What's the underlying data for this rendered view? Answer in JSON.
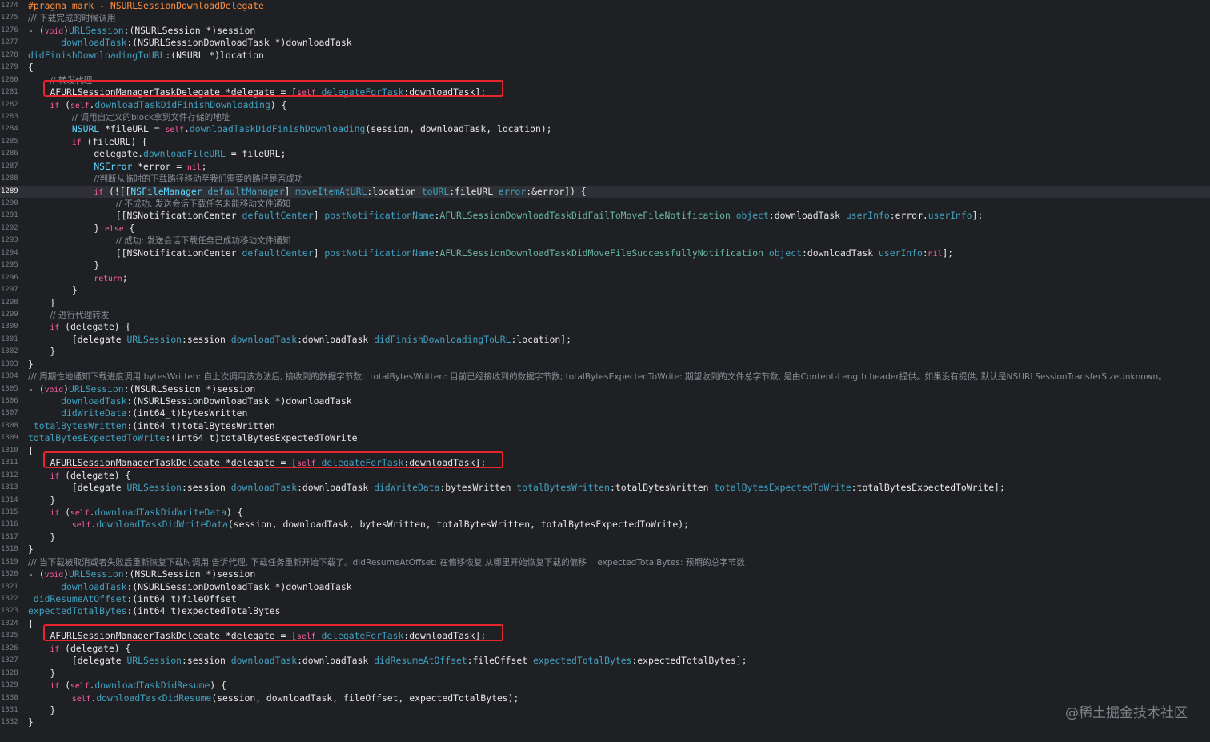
{
  "lines": [
    {
      "n": "1274",
      "indent": 0,
      "tokens": [
        {
          "t": "#pragma mark - NSURLSessionDownloadDelegate",
          "c": "pp"
        }
      ]
    },
    {
      "n": "1275",
      "indent": 0,
      "tokens": [
        {
          "t": "/// 下载完成的时候调用",
          "c": "cm"
        }
      ]
    },
    {
      "n": "1276",
      "indent": 0,
      "tokens": [
        {
          "t": "- (",
          "c": "pl"
        },
        {
          "t": "void",
          "c": "kw"
        },
        {
          "t": ")",
          "c": "pl"
        },
        {
          "t": "URLSession",
          "c": "mt"
        },
        {
          "t": ":(NSURLSession *)session",
          "c": "pl"
        }
      ]
    },
    {
      "n": "1277",
      "indent": 6,
      "tokens": [
        {
          "t": "downloadTask",
          "c": "mt"
        },
        {
          "t": ":(NSURLSessionDownloadTask *)downloadTask",
          "c": "pl"
        }
      ]
    },
    {
      "n": "1278",
      "indent": 0,
      "tokens": [
        {
          "t": "didFinishDownloadingToURL",
          "c": "mt"
        },
        {
          "t": ":(NSURL *)location",
          "c": "pl"
        }
      ]
    },
    {
      "n": "1279",
      "indent": 0,
      "tokens": [
        {
          "t": "{",
          "c": "pl"
        }
      ]
    },
    {
      "n": "1280",
      "indent": 4,
      "tokens": [
        {
          "t": "// 转发代理",
          "c": "cm"
        }
      ]
    },
    {
      "n": "1281",
      "indent": 4,
      "tokens": [
        {
          "t": "AFURLSessionManagerTaskDelegate *delegate = [",
          "c": "pl"
        },
        {
          "t": "self",
          "c": "kw"
        },
        {
          "t": " ",
          "c": "pl"
        },
        {
          "t": "delegateForTask",
          "c": "mt"
        },
        {
          "t": ":downloadTask];",
          "c": "pl"
        }
      ]
    },
    {
      "n": "1282",
      "indent": 4,
      "tokens": [
        {
          "t": "if",
          "c": "kw"
        },
        {
          "t": " (",
          "c": "pl"
        },
        {
          "t": "self",
          "c": "kw"
        },
        {
          "t": ".",
          "c": "pl"
        },
        {
          "t": "downloadTaskDidFinishDownloading",
          "c": "mt"
        },
        {
          "t": ") {",
          "c": "pl"
        }
      ]
    },
    {
      "n": "1283",
      "indent": 8,
      "tokens": [
        {
          "t": "// 调用自定义的block拿到文件存储的地址",
          "c": "cm"
        }
      ]
    },
    {
      "n": "1284",
      "indent": 8,
      "tokens": [
        {
          "t": "NSURL",
          "c": "ty"
        },
        {
          "t": " *fileURL = ",
          "c": "pl"
        },
        {
          "t": "self",
          "c": "kw"
        },
        {
          "t": ".",
          "c": "pl"
        },
        {
          "t": "downloadTaskDidFinishDownloading",
          "c": "mt"
        },
        {
          "t": "(session, downloadTask, location);",
          "c": "pl"
        }
      ]
    },
    {
      "n": "1285",
      "indent": 8,
      "tokens": [
        {
          "t": "if",
          "c": "kw"
        },
        {
          "t": " (fileURL) {",
          "c": "pl"
        }
      ]
    },
    {
      "n": "1286",
      "indent": 12,
      "tokens": [
        {
          "t": "delegate.",
          "c": "pl"
        },
        {
          "t": "downloadFileURL",
          "c": "mt"
        },
        {
          "t": " = fileURL;",
          "c": "pl"
        }
      ]
    },
    {
      "n": "1287",
      "indent": 12,
      "tokens": [
        {
          "t": "NSError",
          "c": "ty"
        },
        {
          "t": " *error = ",
          "c": "pl"
        },
        {
          "t": "nil",
          "c": "kw"
        },
        {
          "t": ";",
          "c": "pl"
        }
      ]
    },
    {
      "n": "1288",
      "indent": 12,
      "tokens": [
        {
          "t": "//判断从临时的下载路径移动至我们需要的路径是否成功",
          "c": "cm"
        }
      ]
    },
    {
      "n": "1289",
      "indent": 12,
      "current": true,
      "tokens": [
        {
          "t": "if",
          "c": "kw"
        },
        {
          "t": " (![[",
          "c": "pl"
        },
        {
          "t": "NSFileManager",
          "c": "ty"
        },
        {
          "t": " ",
          "c": "pl"
        },
        {
          "t": "defaultManager",
          "c": "mt"
        },
        {
          "t": "] ",
          "c": "pl"
        },
        {
          "t": "moveItemAtURL",
          "c": "mt"
        },
        {
          "t": ":location ",
          "c": "pl"
        },
        {
          "t": "toURL",
          "c": "mt"
        },
        {
          "t": ":fileURL ",
          "c": "pl"
        },
        {
          "t": "error",
          "c": "mt"
        },
        {
          "t": ":&error]) {",
          "c": "pl"
        }
      ]
    },
    {
      "n": "1290",
      "indent": 16,
      "tokens": [
        {
          "t": "// 不成功, 发送会话下载任务未能移动文件通知",
          "c": "cm"
        }
      ]
    },
    {
      "n": "1291",
      "indent": 16,
      "tokens": [
        {
          "t": "[[",
          "c": "pl"
        },
        {
          "t": "NSNotificationCenter",
          "c": "pl"
        },
        {
          "t": " ",
          "c": "pl"
        },
        {
          "t": "defaultCenter",
          "c": "mt"
        },
        {
          "t": "] ",
          "c": "pl"
        },
        {
          "t": "postNotificationName",
          "c": "mt"
        },
        {
          "t": ":",
          "c": "pl"
        },
        {
          "t": "AFURLSessionDownloadTaskDidFailToMoveFileNotification",
          "c": "fn"
        },
        {
          "t": " ",
          "c": "pl"
        },
        {
          "t": "object",
          "c": "mt"
        },
        {
          "t": ":downloadTask ",
          "c": "pl"
        },
        {
          "t": "userInfo",
          "c": "mt"
        },
        {
          "t": ":error.",
          "c": "pl"
        },
        {
          "t": "userInfo",
          "c": "mt"
        },
        {
          "t": "];",
          "c": "pl"
        }
      ]
    },
    {
      "n": "1292",
      "indent": 12,
      "tokens": [
        {
          "t": "} ",
          "c": "pl"
        },
        {
          "t": "else",
          "c": "kw"
        },
        {
          "t": " {",
          "c": "pl"
        }
      ]
    },
    {
      "n": "1293",
      "indent": 16,
      "tokens": [
        {
          "t": "// 成功: 发送会话下载任务已成功移动文件通知",
          "c": "cm"
        }
      ]
    },
    {
      "n": "1294",
      "indent": 16,
      "tokens": [
        {
          "t": "[[",
          "c": "pl"
        },
        {
          "t": "NSNotificationCenter",
          "c": "pl"
        },
        {
          "t": " ",
          "c": "pl"
        },
        {
          "t": "defaultCenter",
          "c": "mt"
        },
        {
          "t": "] ",
          "c": "pl"
        },
        {
          "t": "postNotificationName",
          "c": "mt"
        },
        {
          "t": ":",
          "c": "pl"
        },
        {
          "t": "AFURLSessionDownloadTaskDidMoveFileSuccessfullyNotification",
          "c": "fn"
        },
        {
          "t": " ",
          "c": "pl"
        },
        {
          "t": "object",
          "c": "mt"
        },
        {
          "t": ":downloadTask ",
          "c": "pl"
        },
        {
          "t": "userInfo",
          "c": "mt"
        },
        {
          "t": ":",
          "c": "pl"
        },
        {
          "t": "nil",
          "c": "kw"
        },
        {
          "t": "];",
          "c": "pl"
        }
      ]
    },
    {
      "n": "1295",
      "indent": 12,
      "tokens": [
        {
          "t": "}",
          "c": "pl"
        }
      ]
    },
    {
      "n": "1296",
      "indent": 12,
      "tokens": [
        {
          "t": "return",
          "c": "kw"
        },
        {
          "t": ";",
          "c": "pl"
        }
      ]
    },
    {
      "n": "1297",
      "indent": 8,
      "tokens": [
        {
          "t": "}",
          "c": "pl"
        }
      ]
    },
    {
      "n": "1298",
      "indent": 4,
      "tokens": [
        {
          "t": "}",
          "c": "pl"
        }
      ]
    },
    {
      "n": "1299",
      "indent": 4,
      "tokens": [
        {
          "t": "// 进行代理转发",
          "c": "cm"
        }
      ]
    },
    {
      "n": "1300",
      "indent": 4,
      "tokens": [
        {
          "t": "if",
          "c": "kw"
        },
        {
          "t": " (delegate) {",
          "c": "pl"
        }
      ]
    },
    {
      "n": "1301",
      "indent": 8,
      "tokens": [
        {
          "t": "[delegate ",
          "c": "pl"
        },
        {
          "t": "URLSession",
          "c": "mt"
        },
        {
          "t": ":session ",
          "c": "pl"
        },
        {
          "t": "downloadTask",
          "c": "mt"
        },
        {
          "t": ":downloadTask ",
          "c": "pl"
        },
        {
          "t": "didFinishDownloadingToURL",
          "c": "mt"
        },
        {
          "t": ":location];",
          "c": "pl"
        }
      ]
    },
    {
      "n": "1302",
      "indent": 4,
      "tokens": [
        {
          "t": "}",
          "c": "pl"
        }
      ]
    },
    {
      "n": "1303",
      "indent": 0,
      "tokens": [
        {
          "t": "}",
          "c": "pl"
        }
      ]
    },
    {
      "n": "1304",
      "indent": 0,
      "tokens": [
        {
          "t": "/// 周期性地通知下载进度调用 bytesWritten: 自上次调用该方法后, 接收到的数据字节数;  totalBytesWritten: 目前已经接收到的数据字节数; totalBytesExpectedToWrite: 期望收到的文件总字节数, 是由Content-Length header提供。如果没有提供, 默认是NSURLSessionTransferSizeUnknown。",
          "c": "cm"
        }
      ]
    },
    {
      "n": "1305",
      "indent": 0,
      "tokens": [
        {
          "t": "- (",
          "c": "pl"
        },
        {
          "t": "void",
          "c": "kw"
        },
        {
          "t": ")",
          "c": "pl"
        },
        {
          "t": "URLSession",
          "c": "mt"
        },
        {
          "t": ":(NSURLSession *)session",
          "c": "pl"
        }
      ]
    },
    {
      "n": "1306",
      "indent": 6,
      "tokens": [
        {
          "t": "downloadTask",
          "c": "mt"
        },
        {
          "t": ":(NSURLSessionDownloadTask *)downloadTask",
          "c": "pl"
        }
      ]
    },
    {
      "n": "1307",
      "indent": 6,
      "tokens": [
        {
          "t": "didWriteData",
          "c": "mt"
        },
        {
          "t": ":(int64_t)bytesWritten",
          "c": "pl"
        }
      ]
    },
    {
      "n": "1308",
      "indent": 1,
      "tokens": [
        {
          "t": "totalBytesWritten",
          "c": "mt"
        },
        {
          "t": ":(int64_t)totalBytesWritten",
          "c": "pl"
        }
      ]
    },
    {
      "n": "1309",
      "indent": 0,
      "tokens": [
        {
          "t": "totalBytesExpectedToWrite",
          "c": "mt"
        },
        {
          "t": ":(int64_t)totalBytesExpectedToWrite",
          "c": "pl"
        }
      ]
    },
    {
      "n": "1310",
      "indent": 0,
      "tokens": [
        {
          "t": "{",
          "c": "pl"
        }
      ]
    },
    {
      "n": "1311",
      "indent": 4,
      "tokens": [
        {
          "t": "AFURLSessionManagerTaskDelegate *delegate = [",
          "c": "pl"
        },
        {
          "t": "self",
          "c": "kw"
        },
        {
          "t": " ",
          "c": "pl"
        },
        {
          "t": "delegateForTask",
          "c": "mt"
        },
        {
          "t": ":downloadTask];",
          "c": "pl"
        }
      ]
    },
    {
      "n": "1312",
      "indent": 4,
      "tokens": [
        {
          "t": "if",
          "c": "kw"
        },
        {
          "t": " (delegate) {",
          "c": "pl"
        }
      ]
    },
    {
      "n": "1313",
      "indent": 8,
      "tokens": [
        {
          "t": "[delegate ",
          "c": "pl"
        },
        {
          "t": "URLSession",
          "c": "mt"
        },
        {
          "t": ":session ",
          "c": "pl"
        },
        {
          "t": "downloadTask",
          "c": "mt"
        },
        {
          "t": ":downloadTask ",
          "c": "pl"
        },
        {
          "t": "didWriteData",
          "c": "mt"
        },
        {
          "t": ":bytesWritten ",
          "c": "pl"
        },
        {
          "t": "totalBytesWritten",
          "c": "mt"
        },
        {
          "t": ":totalBytesWritten ",
          "c": "pl"
        },
        {
          "t": "totalBytesExpectedToWrite",
          "c": "mt"
        },
        {
          "t": ":totalBytesExpectedToWrite];",
          "c": "pl"
        }
      ]
    },
    {
      "n": "1314",
      "indent": 4,
      "tokens": [
        {
          "t": "}",
          "c": "pl"
        }
      ]
    },
    {
      "n": "1315",
      "indent": 4,
      "tokens": [
        {
          "t": "if",
          "c": "kw"
        },
        {
          "t": " (",
          "c": "pl"
        },
        {
          "t": "self",
          "c": "kw"
        },
        {
          "t": ".",
          "c": "pl"
        },
        {
          "t": "downloadTaskDidWriteData",
          "c": "mt"
        },
        {
          "t": ") {",
          "c": "pl"
        }
      ]
    },
    {
      "n": "1316",
      "indent": 8,
      "tokens": [
        {
          "t": "self",
          "c": "kw"
        },
        {
          "t": ".",
          "c": "pl"
        },
        {
          "t": "downloadTaskDidWriteData",
          "c": "mt"
        },
        {
          "t": "(session, downloadTask, bytesWritten, totalBytesWritten, totalBytesExpectedToWrite);",
          "c": "pl"
        }
      ]
    },
    {
      "n": "1317",
      "indent": 4,
      "tokens": [
        {
          "t": "}",
          "c": "pl"
        }
      ]
    },
    {
      "n": "1318",
      "indent": 0,
      "tokens": [
        {
          "t": "}",
          "c": "pl"
        }
      ]
    },
    {
      "n": "1319",
      "indent": 0,
      "tokens": [
        {
          "t": "/// 当下载被取消或者失败后重新恢复下载时调用 告诉代理, 下载任务重新开始下载了。didResumeAtOffset: 在偏移恢复 从哪里开始恢复下载的偏移    expectedTotalBytes: 预期的总字节数",
          "c": "cm"
        }
      ]
    },
    {
      "n": "1320",
      "indent": 0,
      "tokens": [
        {
          "t": "- (",
          "c": "pl"
        },
        {
          "t": "void",
          "c": "kw"
        },
        {
          "t": ")",
          "c": "pl"
        },
        {
          "t": "URLSession",
          "c": "mt"
        },
        {
          "t": ":(NSURLSession *)session",
          "c": "pl"
        }
      ]
    },
    {
      "n": "1321",
      "indent": 6,
      "tokens": [
        {
          "t": "downloadTask",
          "c": "mt"
        },
        {
          "t": ":(NSURLSessionDownloadTask *)downloadTask",
          "c": "pl"
        }
      ]
    },
    {
      "n": "1322",
      "indent": 1,
      "tokens": [
        {
          "t": "didResumeAtOffset",
          "c": "mt"
        },
        {
          "t": ":(int64_t)fileOffset",
          "c": "pl"
        }
      ]
    },
    {
      "n": "1323",
      "indent": 0,
      "tokens": [
        {
          "t": "expectedTotalBytes",
          "c": "mt"
        },
        {
          "t": ":(int64_t)expectedTotalBytes",
          "c": "pl"
        }
      ]
    },
    {
      "n": "1324",
      "indent": 0,
      "tokens": [
        {
          "t": "{",
          "c": "pl"
        }
      ]
    },
    {
      "n": "1325",
      "indent": 4,
      "tokens": [
        {
          "t": "AFURLSessionManagerTaskDelegate *delegate = [",
          "c": "pl"
        },
        {
          "t": "self",
          "c": "kw"
        },
        {
          "t": " ",
          "c": "pl"
        },
        {
          "t": "delegateForTask",
          "c": "mt"
        },
        {
          "t": ":downloadTask];",
          "c": "pl"
        }
      ]
    },
    {
      "n": "1326",
      "indent": 4,
      "tokens": [
        {
          "t": "if",
          "c": "kw"
        },
        {
          "t": " (delegate) {",
          "c": "pl"
        }
      ]
    },
    {
      "n": "1327",
      "indent": 8,
      "tokens": [
        {
          "t": "[delegate ",
          "c": "pl"
        },
        {
          "t": "URLSession",
          "c": "mt"
        },
        {
          "t": ":session ",
          "c": "pl"
        },
        {
          "t": "downloadTask",
          "c": "mt"
        },
        {
          "t": ":downloadTask ",
          "c": "pl"
        },
        {
          "t": "didResumeAtOffset",
          "c": "mt"
        },
        {
          "t": ":fileOffset ",
          "c": "pl"
        },
        {
          "t": "expectedTotalBytes",
          "c": "mt"
        },
        {
          "t": ":expectedTotalBytes];",
          "c": "pl"
        }
      ]
    },
    {
      "n": "1328",
      "indent": 4,
      "tokens": [
        {
          "t": "}",
          "c": "pl"
        }
      ]
    },
    {
      "n": "1329",
      "indent": 4,
      "tokens": [
        {
          "t": "if",
          "c": "kw"
        },
        {
          "t": " (",
          "c": "pl"
        },
        {
          "t": "self",
          "c": "kw"
        },
        {
          "t": ".",
          "c": "pl"
        },
        {
          "t": "downloadTaskDidResume",
          "c": "mt"
        },
        {
          "t": ") {",
          "c": "pl"
        }
      ]
    },
    {
      "n": "1330",
      "indent": 8,
      "tokens": [
        {
          "t": "self",
          "c": "kw"
        },
        {
          "t": ".",
          "c": "pl"
        },
        {
          "t": "downloadTaskDidResume",
          "c": "mt"
        },
        {
          "t": "(session, downloadTask, fileOffset, expectedTotalBytes);",
          "c": "pl"
        }
      ]
    },
    {
      "n": "1331",
      "indent": 4,
      "tokens": [
        {
          "t": "}",
          "c": "pl"
        }
      ]
    },
    {
      "n": "1332",
      "indent": 0,
      "tokens": [
        {
          "t": "}",
          "c": "pl"
        }
      ]
    }
  ],
  "highlighted_lines": [
    "1281",
    "1311",
    "1325"
  ],
  "watermark": "@稀土掘金技术社区",
  "colors": {
    "background": "#1f2024",
    "current_line": "#2f3035",
    "highlight_box": "#e8242c",
    "plain": "#e6e6e6",
    "comment": "#7b8088",
    "keyword": "#fc5fa3",
    "preprocessor": "#fd8f3f",
    "type": "#5dd8ff",
    "method": "#41a1c0",
    "constant": "#67b7a4"
  }
}
